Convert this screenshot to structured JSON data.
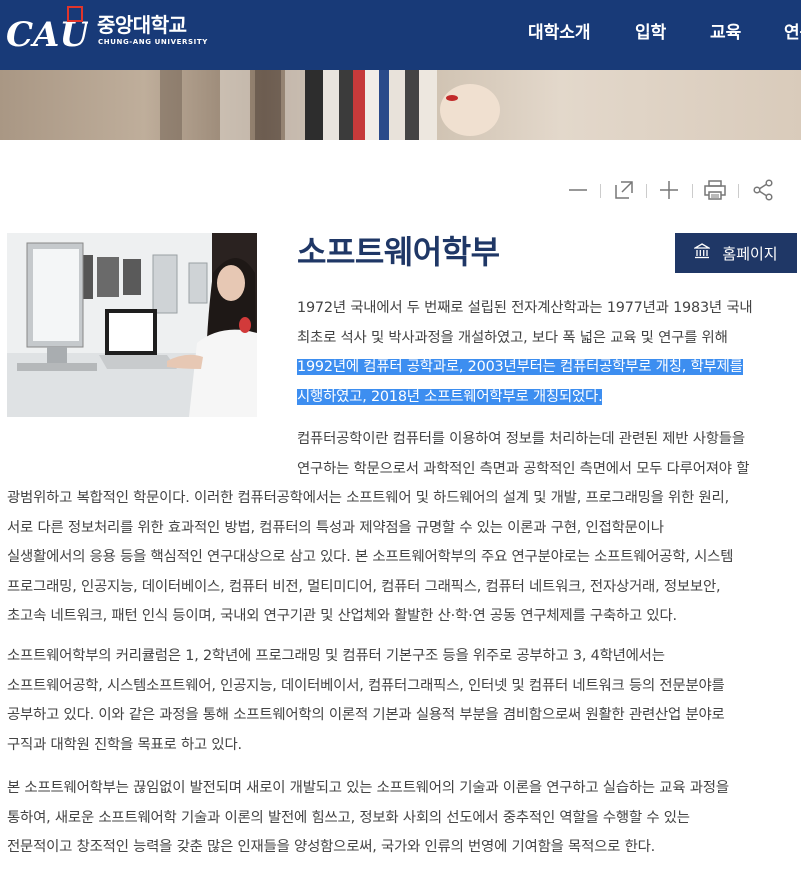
{
  "header": {
    "logo_text": "CAU",
    "school_name_kor": "중앙대학교",
    "school_name_eng": "CHUNG-ANG UNIVERSITY",
    "nav": [
      "대학소개",
      "입학",
      "교육",
      "연구"
    ]
  },
  "tools": {
    "icons": [
      "minus-icon",
      "expand-icon",
      "plus-icon",
      "print-icon",
      "share-icon"
    ]
  },
  "department": {
    "title": "소프트웨어학부",
    "homepage_label": "홈페이지"
  },
  "intro_lines": [
    "1972년 국내에서 두 번째로 설립된 전자계산학과는 1977년과 1983년 국내",
    "최초로 석사 및 박사과정을 개설하였고, 보다 폭 넓은 교육 및 연구를 위해"
  ],
  "intro_selected_lines": [
    "1992년에 컴퓨터 공학과로, 2003년부터는 컴퓨터공학부로 개칭, 학부제를",
    "시행하였고, 2018년 소프트웨어학부로 개칭되었다."
  ],
  "para1_indented_lines": [
    "컴퓨터공학이란 컴퓨터를 이용하여 정보를 처리하는데 관련된 제반 사항들을",
    "연구하는 학문으로서 과학적인 측면과 공학적인 측면에서 모두 다루어져야 할"
  ],
  "para1_lines": [
    "광범위하고 복합적인 학문이다. 이러한 컴퓨터공학에서는 소프트웨어 및 하드웨어의 설계 및 개발, 프로그래밍을 위한 원리,",
    "서로 다른 정보처리를 위한 효과적인 방법, 컴퓨터의 특성과 제약점을 규명할 수 있는 이론과 구현, 인접학문이나",
    "실생활에서의 응용 등을 핵심적인 연구대상으로 삼고 있다. 본 소프트웨어학부의 주요 연구분야로는 소프트웨어공학, 시스템",
    "프로그래밍, 인공지능, 데이터베이스, 컴퓨터 비전, 멀티미디어, 컴퓨터 그래픽스, 컴퓨터 네트워크, 전자상거래, 정보보안,",
    "초고속 네트워크, 패턴 인식 등이며, 국내외 연구기관 및 산업체와 활발한 산·학·연 공동 연구체제를 구축하고 있다."
  ],
  "para2_lines": [
    "소프트웨어학부의 커리큘럼은 1, 2학년에 프로그래밍 및 컴퓨터 기본구조 등을 위주로 공부하고 3, 4학년에서는",
    "소프트웨어공학, 시스템소프트웨어, 인공지능, 데이터베이서, 컴퓨터그래픽스, 인터넷 및 컴퓨터 네트워크 등의 전문분야를",
    "공부하고 있다. 이와 같은 과정을 통해 소프트웨어학의 이론적 기본과 실용적 부분을 겸비함으로써 원활한 관련산업 분야로",
    "구직과 대학원 진학을 목표로 하고 있다."
  ],
  "para3_lines": [
    "본 소프트웨어학부는 끊임없이 발전되며 새로이 개발되고 있는 소프트웨어의 기술과 이론을 연구하고 실습하는 교육 과정을",
    "통하여, 새로운 소프트웨어학 기술과 이론의 발전에 힘쓰고, 정보화 사회의 선도에서 중추적인 역할을 수행할 수 있는",
    "전문적이고 창조적인 능력을 갖춘 많은 인재들을 양성함으로써, 국가와 인류의 번영에 기여함을 목적으로 한다."
  ],
  "colors": {
    "brand_navy": "#183a78",
    "title_navy": "#1f3766",
    "selection": "#3d8ef0",
    "logo_red": "#e0352b"
  }
}
